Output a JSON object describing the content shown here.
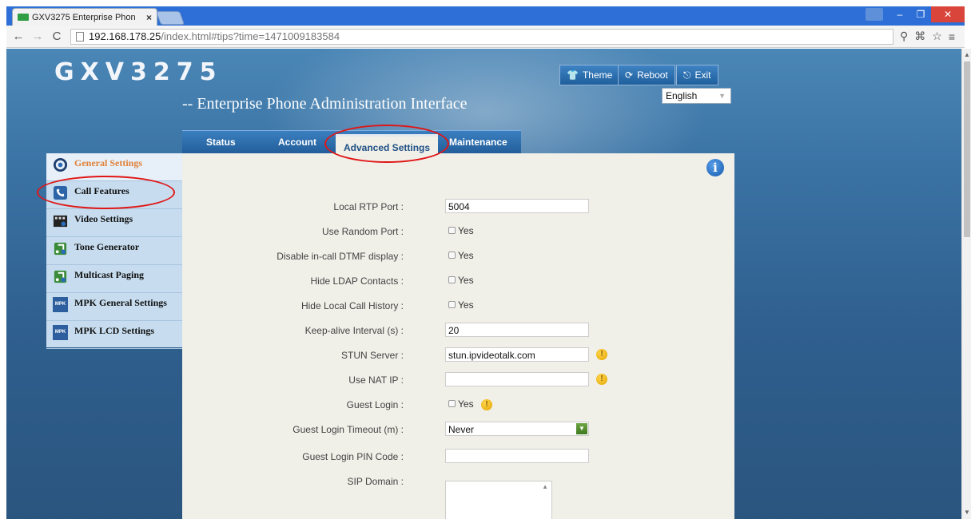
{
  "browser": {
    "tab_title": "GXV3275 Enterprise Phon",
    "tab_close": "×",
    "url_host": "192.168.178.25",
    "url_path": "/index.html#tips?time=1471009183584",
    "win_min": "–",
    "win_restore": "❐",
    "win_close": "✕"
  },
  "header": {
    "logo": "GXV3275",
    "subtitle": "-- Enterprise Phone Administration Interface",
    "theme_label": "Theme",
    "reboot_label": "Reboot",
    "exit_label": "Exit",
    "language": "English"
  },
  "nav": {
    "tabs": [
      "Status",
      "Account",
      "Advanced Settings",
      "Maintenance"
    ]
  },
  "sidebar": {
    "items": [
      {
        "label": "General Settings",
        "icon": "gear-icon"
      },
      {
        "label": "Call Features",
        "icon": "phone-icon"
      },
      {
        "label": "Video Settings",
        "icon": "video-icon"
      },
      {
        "label": "Tone Generator",
        "icon": "music-note-icon"
      },
      {
        "label": "Multicast Paging",
        "icon": "music-note-icon"
      },
      {
        "label": "MPK General Settings",
        "icon": "mpk-icon"
      },
      {
        "label": "MPK LCD Settings",
        "icon": "mpk-icon"
      }
    ],
    "mpk_badge": "MPK"
  },
  "form": {
    "local_rtp_port": {
      "label": "Local RTP Port :",
      "value": "5004"
    },
    "use_random_port": {
      "label": "Use Random Port :",
      "option": "Yes"
    },
    "disable_dtmf": {
      "label": "Disable in-call DTMF display :",
      "option": "Yes"
    },
    "hide_ldap": {
      "label": "Hide LDAP Contacts :",
      "option": "Yes"
    },
    "hide_call_history": {
      "label": "Hide Local Call History :",
      "option": "Yes"
    },
    "keepalive": {
      "label": "Keep-alive Interval (s) :",
      "value": "20"
    },
    "stun_server": {
      "label": "STUN Server :",
      "value": "stun.ipvideotalk.com"
    },
    "use_nat_ip": {
      "label": "Use NAT IP :",
      "value": ""
    },
    "guest_login": {
      "label": "Guest Login :",
      "option": "Yes"
    },
    "guest_timeout": {
      "label": "Guest Login Timeout (m) :",
      "value": "Never"
    },
    "guest_pin": {
      "label": "Guest Login PIN Code :",
      "value": ""
    },
    "sip_domain": {
      "label": "SIP Domain :"
    }
  },
  "icons": {
    "warn_glyph": "!",
    "info_glyph": "i"
  },
  "colors": {
    "accent": "#2d6fd6",
    "active_sidebar": "#e1813a",
    "highlight_ring": "#e01616"
  }
}
